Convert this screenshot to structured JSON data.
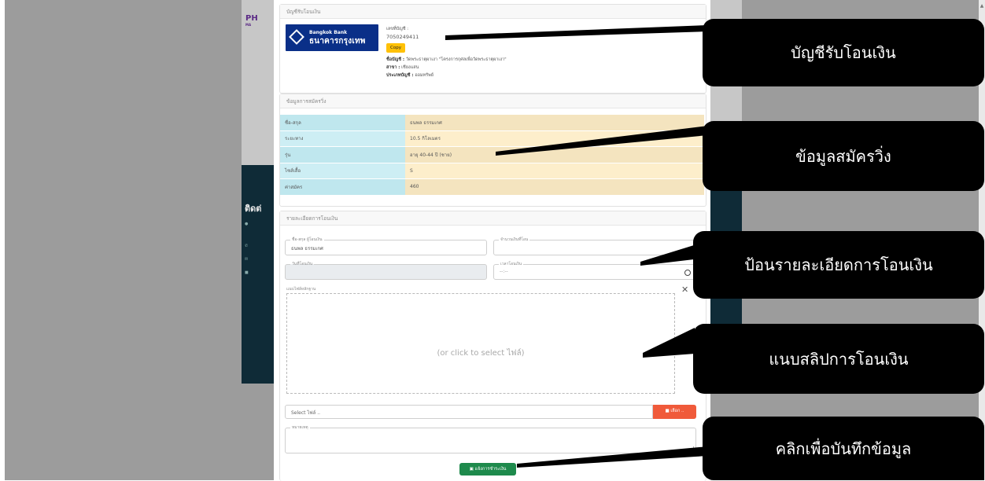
{
  "background": {
    "logo": "PH",
    "logo_sub": "MA",
    "contact_heading": "ติดต่"
  },
  "account_panel": {
    "header": "บัญชีรับโอนเงิน",
    "bank_name_en": "Bangkok Bank",
    "bank_name_th": "ธนาคารกรุงเทพ",
    "account_number_label": "เลขที่บัญชี :",
    "account_number": "7050249411",
    "copy_label": "Copy",
    "account_name_label": "ชื่อบัญชี :",
    "account_name": "วัดพระธาตุผาเงา \"โครงการกุศลเพื่อวัดพระธาตุผาเงา\"",
    "branch_label": "สาขา :",
    "branch": "เชียงแสน",
    "account_type_label": "ประเภทบัญชี :",
    "account_type": "ออมทรัพย์"
  },
  "registration_panel": {
    "header": "ข้อมูลการสมัครวิ่ง",
    "rows": [
      {
        "label": "ชื่อ-สกุล",
        "value": "ธนพล ธรรมเกศ"
      },
      {
        "label": "ระยะทาง",
        "value": "10.5 กิโลเมตร"
      },
      {
        "label": "รุ่น",
        "value": "อายุ 40-44 ปี (ชาย)"
      },
      {
        "label": "ไซส์เสื้อ",
        "value": "S"
      },
      {
        "label": "ค่าสมัคร",
        "value": "460"
      }
    ]
  },
  "transfer_panel": {
    "header": "รายละเอียดการโอนเงิน",
    "payer_name_label": "ชื่อ-สกุล ผู้โอนเงิน",
    "payer_name_value": "ธนพล ธรรมเกศ",
    "amount_label": "จำนวนเงินที่โอน",
    "amount_value": "",
    "date_label": "วันที่โอนเงิน",
    "time_label": "เวลาโอนเงิน",
    "time_placeholder": "--:--",
    "attachment_label": "แนบไฟล์หลักฐาน",
    "dropzone_text": "(or click to select ไฟล์)",
    "file_placeholder": "Select ไฟล์ ..",
    "choose_label": "เลือก ..",
    "remark_label": "หมายเหตุ",
    "submit_label": "แจ้งการชำระเงิน"
  },
  "callouts": [
    {
      "text": "บัญชีรับโอนเงิน"
    },
    {
      "text": "ข้อมูลสมัครวิ่ง"
    },
    {
      "text": "ป้อนรายละเอียดการโอนเงิน"
    },
    {
      "text": "แนบสลิปการโอนเงิน"
    },
    {
      "text": "คลิกเพื่อบันทึกข้อมูล"
    }
  ],
  "colors": {
    "bank_blue": "#0a2f88",
    "copy_yellow": "#ffc107",
    "submit_green": "#1e8a4c",
    "choose_orange": "#f05a3a"
  }
}
